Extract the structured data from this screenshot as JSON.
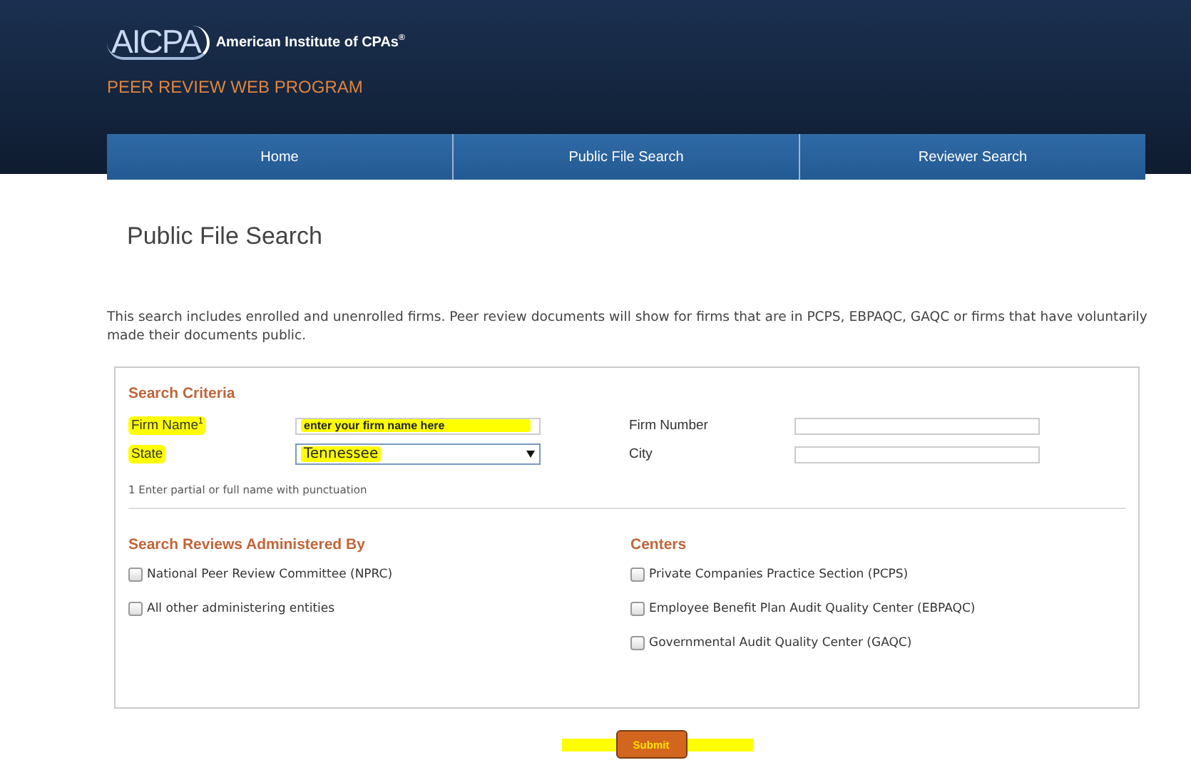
{
  "header": {
    "logo_mark": "AICPA",
    "logo_text": "American Institute of CPAs",
    "logo_reg": "®",
    "program": "PEER REVIEW WEB PROGRAM"
  },
  "nav": [
    {
      "label": "Home",
      "selected": false
    },
    {
      "label": "Public File Search",
      "selected": false
    },
    {
      "label": "Reviewer Search",
      "selected": false
    }
  ],
  "page_title": "Public File Search",
  "intro": "This search includes enrolled and unenrolled firms. Peer review documents will show for firms that are in PCPS, EBPAQC, GAQC or firms that have voluntarily made their documents public.",
  "criteria": {
    "title": "Search Criteria",
    "fields": [
      {
        "label": "Firm Name$^{1}$",
        "kind": "text",
        "placeholder": "enter your firm name here",
        "highlighted": true
      },
      {
        "label": "Firm Number",
        "kind": "text",
        "highlighted": false
      },
      {
        "label": "State",
        "kind": "select",
        "value": "Tennessee",
        "highlighted": true
      },
      {
        "label": "City",
        "kind": "text",
        "highlighted": false
      }
    ],
    "footnote": "1 Enter partial or full name with punctuation"
  },
  "groups": [
    {
      "title": "Search Reviews Administered By",
      "options": [
        {
          "label": "National Peer Review Committee (NPRC)",
          "checked": false
        },
        {
          "label": "All other administering entities",
          "checked": false
        }
      ]
    },
    {
      "title": "Centers",
      "options": [
        {
          "label": "Private Companies Practice Section (PCPS)",
          "checked": false
        },
        {
          "label": "Employee Benefit Plan Audit Quality Center (EBPAQC)",
          "checked": false
        },
        {
          "label": "Governmental Audit Quality Center (GAQC)",
          "checked": false
        }
      ]
    }
  ],
  "submit": {
    "label": "Submit",
    "highlighted": true
  }
}
